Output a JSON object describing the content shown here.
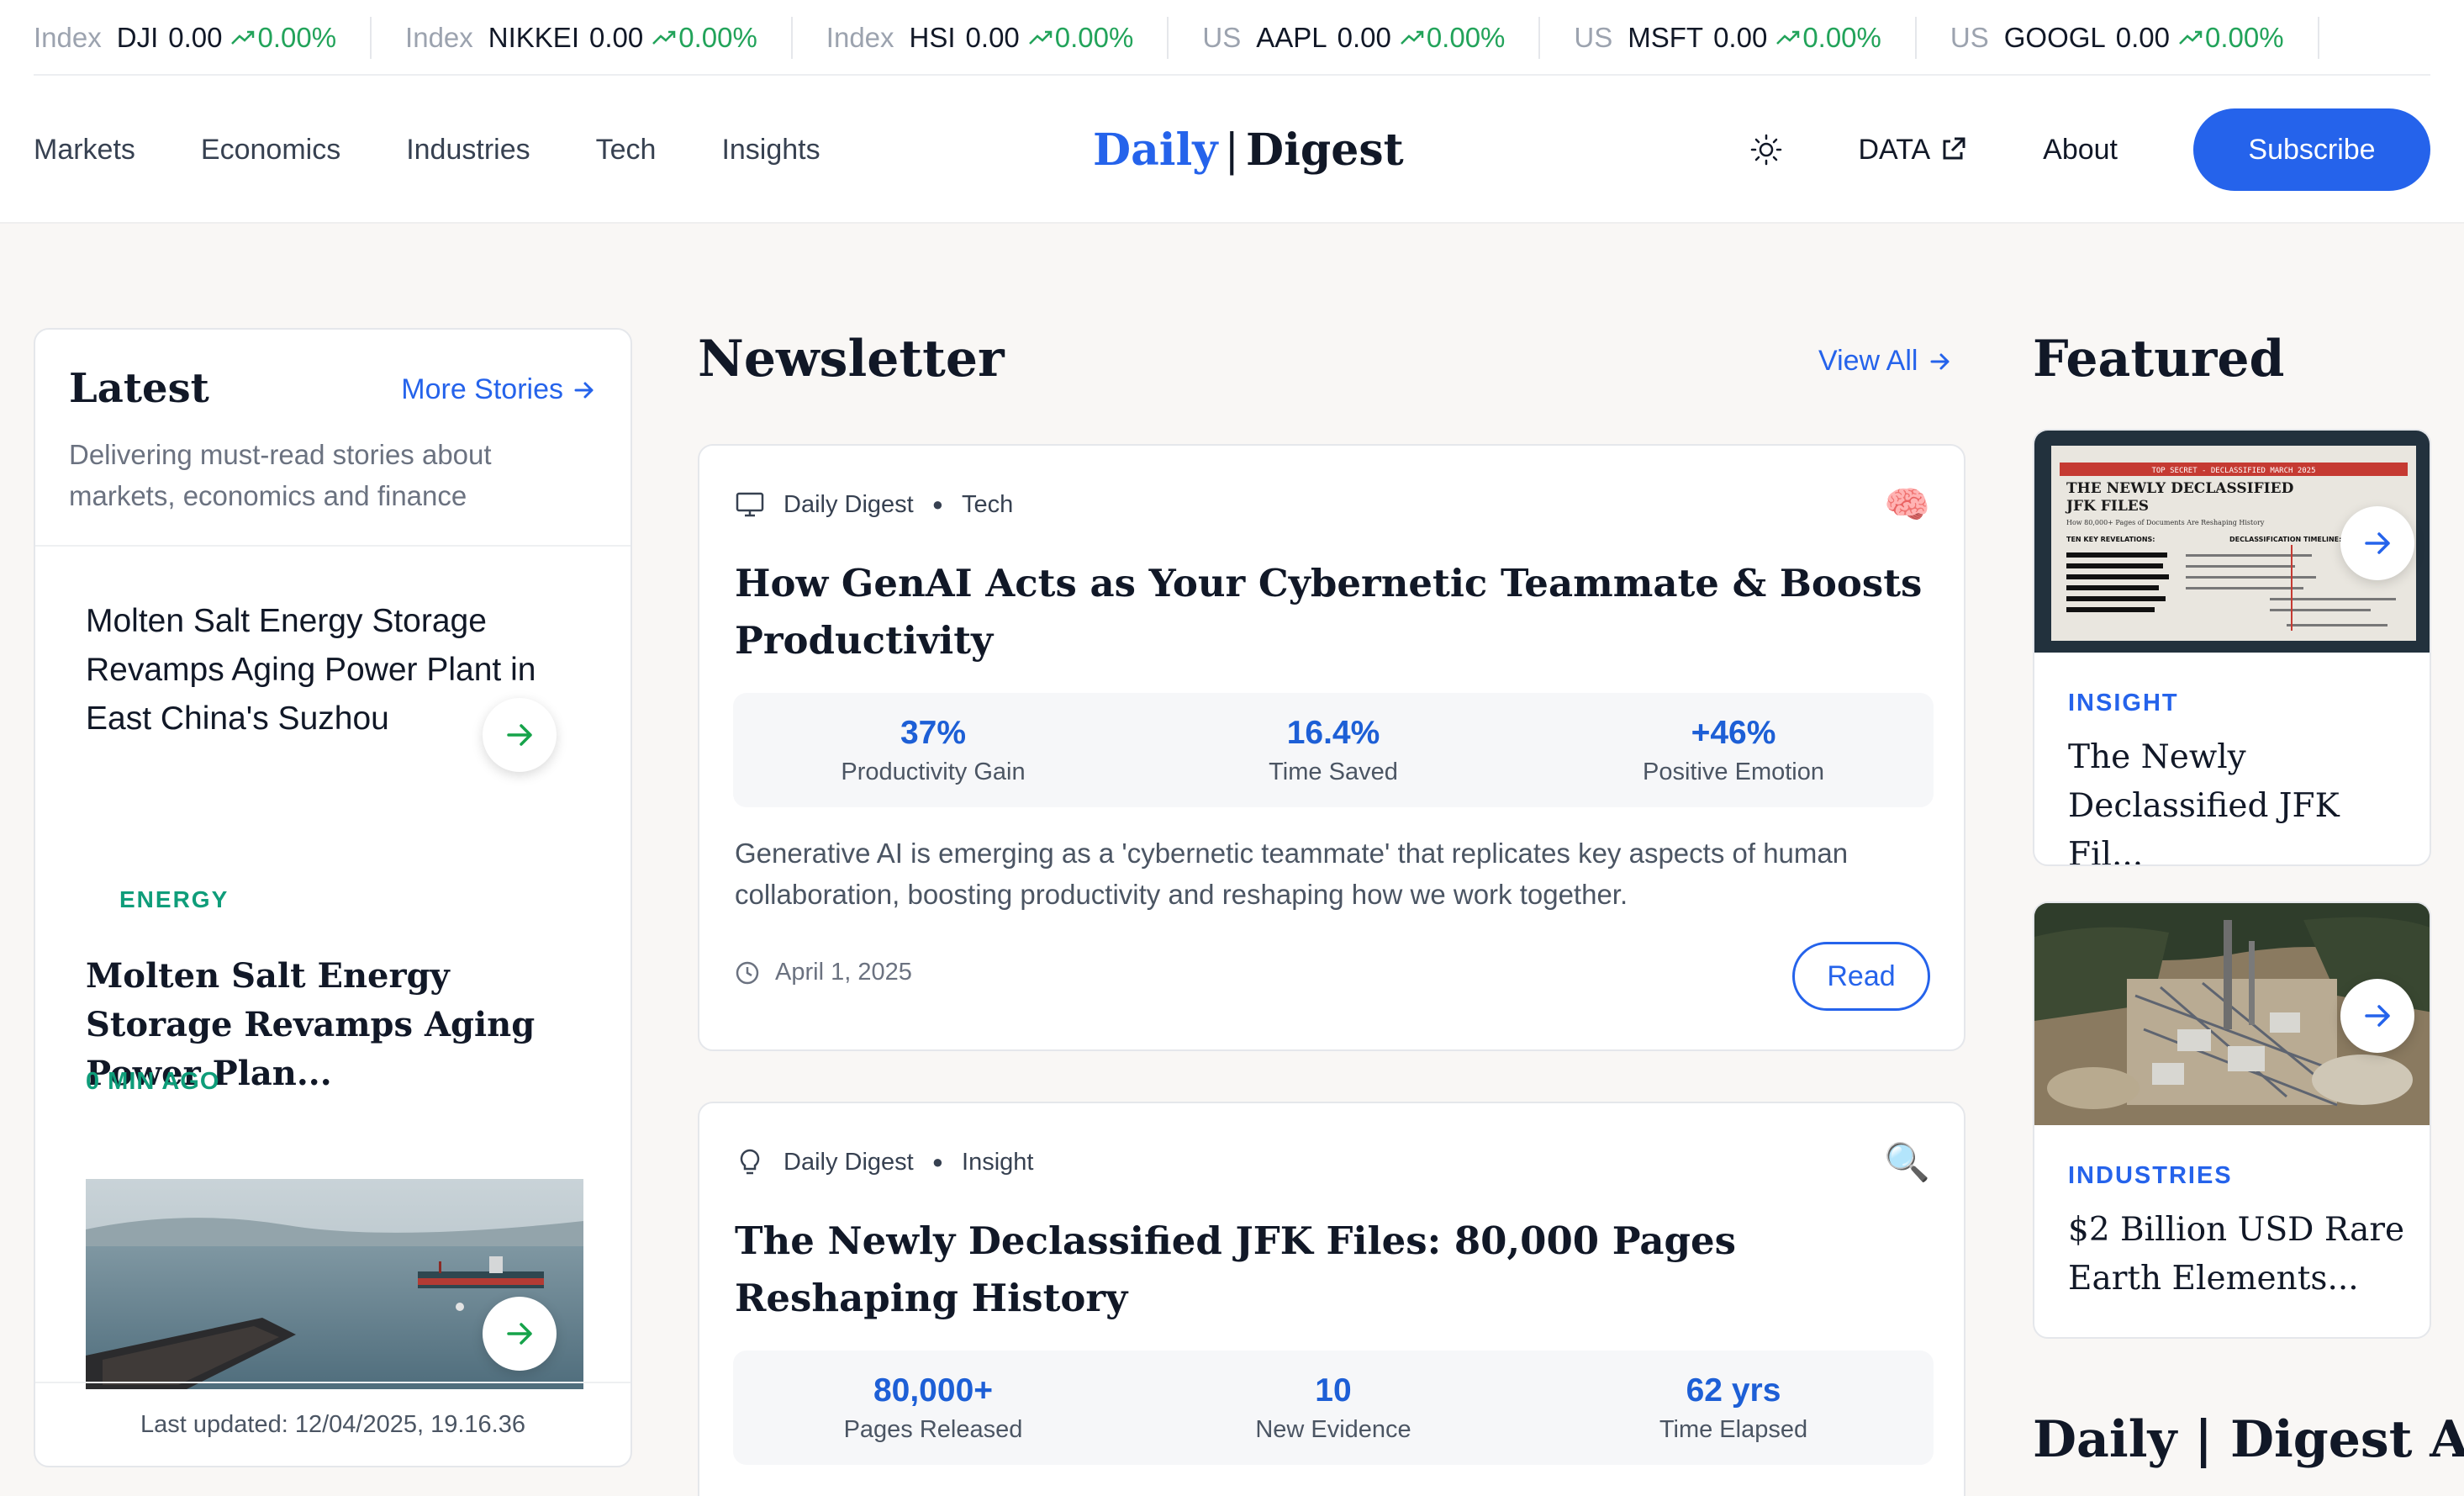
{
  "ticker": [
    {
      "region": "Index",
      "symbol": "DJI",
      "price": "0.00",
      "change": "0.00%"
    },
    {
      "region": "Index",
      "symbol": "NIKKEI",
      "price": "0.00",
      "change": "0.00%"
    },
    {
      "region": "Index",
      "symbol": "HSI",
      "price": "0.00",
      "change": "0.00%"
    },
    {
      "region": "US",
      "symbol": "AAPL",
      "price": "0.00",
      "change": "0.00%"
    },
    {
      "region": "US",
      "symbol": "MSFT",
      "price": "0.00",
      "change": "0.00%"
    },
    {
      "region": "US",
      "symbol": "GOOGL",
      "price": "0.00",
      "change": "0.00%"
    }
  ],
  "header": {
    "nav": [
      "Markets",
      "Economics",
      "Industries",
      "Tech",
      "Insights"
    ],
    "logo_daily": "Daily",
    "logo_sep": "|",
    "logo_digest": "Digest",
    "data_label": "DATA",
    "about_label": "About",
    "subscribe_label": "Subscribe"
  },
  "latest": {
    "title": "Latest",
    "more_label": "More Stories",
    "description": "Delivering must-read stories about markets, economics and finance",
    "story1": "Molten Salt Energy Storage Revamps Aging Power Plant in East China's Suzhou",
    "story2_category": "ENERGY",
    "story2_title": "Molten Salt Energy Storage Revamps Aging Power Plan...",
    "story2_time": "0 MIN AGO",
    "footer": "Last updated: 12/04/2025, 19.16.36"
  },
  "newsletter": {
    "title": "Newsletter",
    "view_all": "View All",
    "cards": [
      {
        "source": "Daily Digest",
        "category": "Tech",
        "emoji": "🧠",
        "headline": "How GenAI Acts as Your Cybernetic Teammate & Boosts Productivity",
        "stats": [
          {
            "value": "37%",
            "label": "Productivity Gain"
          },
          {
            "value": "16.4%",
            "label": "Time Saved"
          },
          {
            "value": "+46%",
            "label": "Positive Emotion"
          }
        ],
        "excerpt": "Generative AI is emerging as a 'cybernetic teammate' that replicates key aspects of human collaboration, boosting productivity and reshaping how we work together.",
        "date": "April 1, 2025",
        "read_label": "Read"
      },
      {
        "source": "Daily Digest",
        "category": "Insight",
        "emoji": "🔍",
        "headline": "The Newly Declassified JFK Files: 80,000 Pages Reshaping History",
        "stats": [
          {
            "value": "80,000+",
            "label": "Pages Released"
          },
          {
            "value": "10",
            "label": "New Evidence"
          },
          {
            "value": "62 yrs",
            "label": "Time Elapsed"
          }
        ]
      }
    ]
  },
  "featured": {
    "title": "Featured",
    "cards": [
      {
        "category": "INSIGHT",
        "title": "The Newly Declassified JFK Fil...",
        "doc_banner": "TOP SECRET - DECLASSIFIED MARCH 2025",
        "doc_title_1": "THE NEWLY DECLASSIFIED",
        "doc_title_2": "JFK FILES",
        "doc_sub": "How 80,000+ Pages of Documents Are Reshaping History",
        "doc_col1": "TEN KEY REVELATIONS:",
        "doc_col2": "DECLASSIFICATION TIMELINE:"
      },
      {
        "category": "INDUSTRIES",
        "title": "$2 Billion USD Rare Earth Elements..."
      }
    ]
  },
  "bottom_brand": "Daily | Digest AI",
  "colors": {
    "accent": "#2563eb",
    "positive": "#22a35a",
    "energy": "#0f9d7a",
    "background": "#f9f7f5"
  }
}
